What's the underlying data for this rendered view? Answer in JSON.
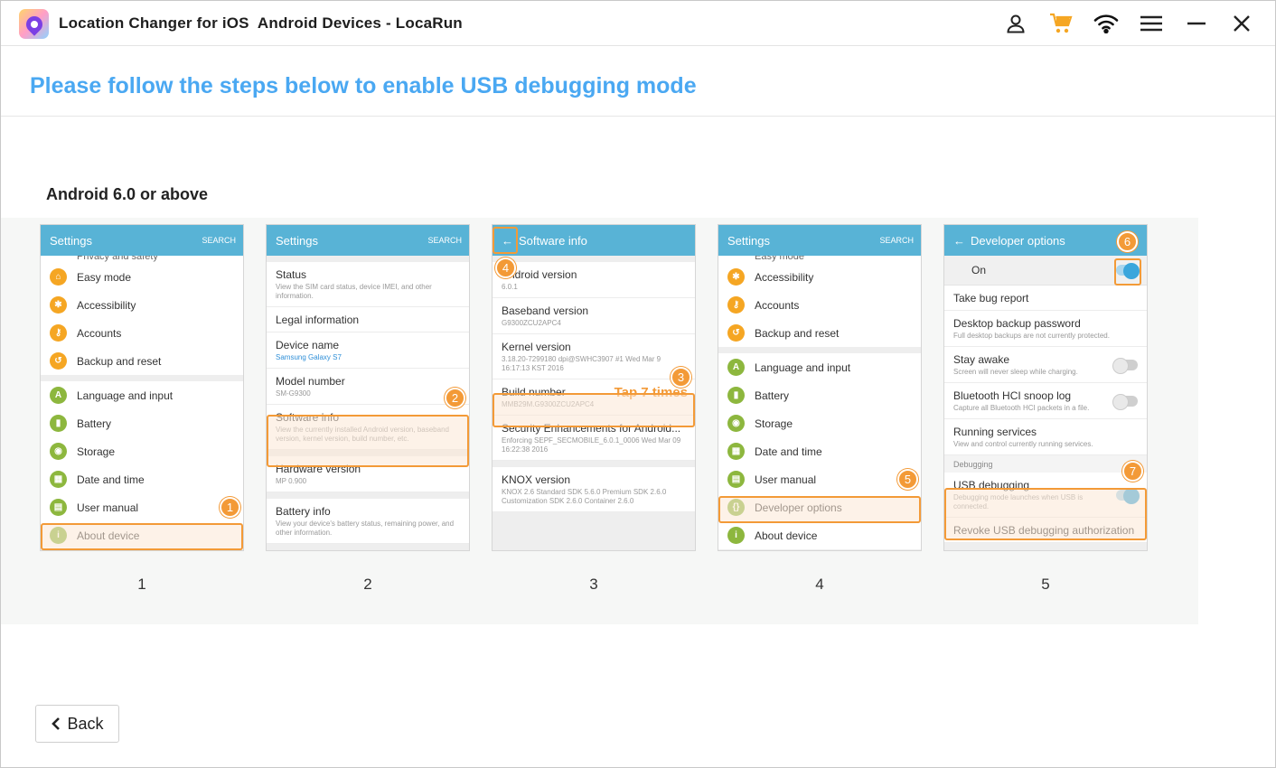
{
  "app": {
    "title": "Location Changer for iOS  Android Devices - LocaRun"
  },
  "titlebar": {
    "icons": [
      "user-icon",
      "cart-icon",
      "wifi-icon",
      "menu-icon",
      "minimize-icon",
      "close-icon"
    ],
    "cart_color": "#f5a623"
  },
  "heading": "Please follow the steps below to enable USB debugging mode",
  "section_label": "Android 6.0 or above",
  "colors": {
    "accent": "#4aa8f2",
    "highlight": "#f39a37",
    "phone_header": "#58b3d6",
    "icon_green": "#8db73e"
  },
  "steps": [
    {
      "number": "1",
      "header": {
        "title": "Settings",
        "search": "SEARCH"
      },
      "cut_text": "Privacy and safety",
      "rows_a": [
        "Easy mode",
        "Accessibility",
        "Accounts",
        "Backup and reset"
      ],
      "rows_b": [
        "Language and input",
        "Battery",
        "Storage",
        "Date and time",
        "User manual",
        "About device"
      ],
      "badge": "1"
    },
    {
      "number": "2",
      "header": {
        "title": "Settings",
        "search": "SEARCH"
      },
      "items": [
        {
          "title": "Status",
          "sub": "View the SIM card status, device IMEI, and other information."
        },
        {
          "title": "Legal information",
          "sub": ""
        },
        {
          "title": "Device name",
          "sub": "Samsung Galaxy S7"
        },
        {
          "title": "Model number",
          "sub": "SM-G9300"
        },
        {
          "title": "Software info",
          "sub": "View the currently installed Android version, baseband version, kernel version, build number, etc."
        },
        {
          "title": "Hardware version",
          "sub": "MP 0.900"
        },
        {
          "title": "Battery info",
          "sub": "View your device's battery status, remaining power, and other information."
        }
      ],
      "badge": "2"
    },
    {
      "number": "3",
      "header": {
        "title": "Software info"
      },
      "items": [
        {
          "title": "Android version",
          "sub": "6.0.1"
        },
        {
          "title": "Baseband version",
          "sub": "G9300ZCU2APC4"
        },
        {
          "title": "Kernel version",
          "sub": "3.18.20-7299180 dpi@SWHC3907 #1 Wed Mar 9 16:17:13 KST 2016"
        },
        {
          "title": "Build number",
          "sub": "MMB29M.G9300ZCU2APC4"
        },
        {
          "title": "Security Enhancements for Android...",
          "sub": "Enforcing SEPF_SECMOBILE_6.0.1_0006 Wed Mar 09 16:22:38 2016"
        },
        {
          "title": "KNOX version",
          "sub": "KNOX 2.6 Standard SDK 5.6.0 Premium SDK 2.6.0 Customization SDK 2.6.0 Container 2.6.0"
        }
      ],
      "tap_label": "Tap 7 times",
      "badges": [
        "3",
        "4"
      ]
    },
    {
      "number": "4",
      "header": {
        "title": "Settings",
        "search": "SEARCH"
      },
      "cut_text": "Easy mode",
      "rows_a": [
        "Accessibility",
        "Accounts",
        "Backup and reset"
      ],
      "rows_b": [
        "Language and input",
        "Battery",
        "Storage",
        "Date and time",
        "User manual",
        "Developer options",
        "About device"
      ],
      "badge": "5"
    },
    {
      "number": "5",
      "header": {
        "title": "Developer options"
      },
      "on_label": "On",
      "items_a": [
        {
          "title": "Take bug report",
          "sub": ""
        },
        {
          "title": "Desktop backup password",
          "sub": "Full desktop backups are not currently protected."
        },
        {
          "title": "Stay awake",
          "sub": "Screen will never sleep while charging."
        },
        {
          "title": "Bluetooth HCI snoop log",
          "sub": "Capture all Bluetooth HCI packets in a file."
        },
        {
          "title": "Running services",
          "sub": "View and control currently running services."
        }
      ],
      "debug_label": "Debugging",
      "usb": {
        "title": "USB debugging",
        "sub": "Debugging mode launches when USB is connected."
      },
      "revoke": "Revoke USB debugging authorization",
      "badges": [
        "6",
        "7"
      ]
    }
  ],
  "back_button": {
    "label": "Back"
  }
}
